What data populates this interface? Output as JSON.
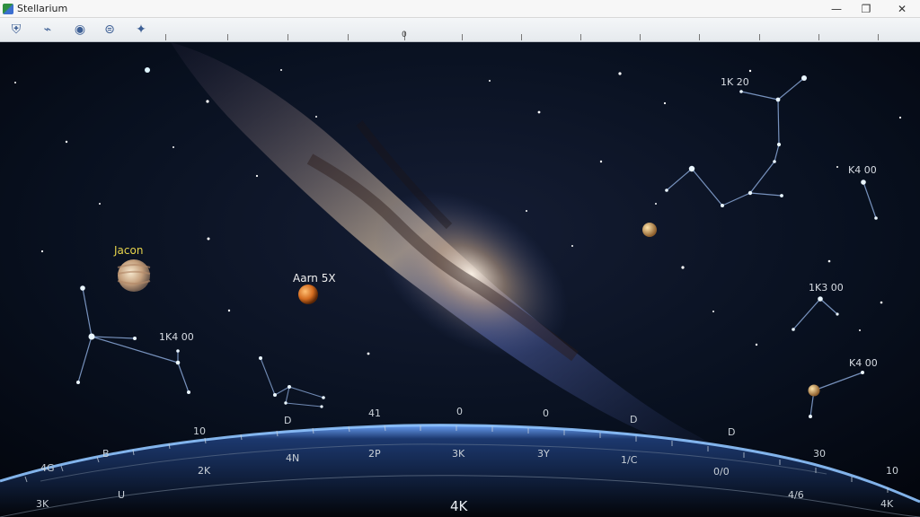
{
  "app": {
    "title": "Stellarium"
  },
  "window_controls": {
    "minimize": "—",
    "maximize": "❐",
    "close": "✕"
  },
  "toolbar": {
    "icons": [
      "shield-icon",
      "telescope-icon",
      "planet-icon",
      "binocular-icon",
      "satellite-icon"
    ],
    "ruler_center_label": "0"
  },
  "sky": {
    "colors": {
      "sky_top": "#04060d",
      "milkyway_core": "#d6c0a4",
      "horizon_glow": "#6fa7ff",
      "constellation": "#8aa8d8"
    },
    "planets": [
      {
        "name": "Jupiter",
        "label": "Jacon"
      },
      {
        "name": "Mars",
        "label": "Aarn 5X"
      },
      {
        "name": "Saturn",
        "label": ""
      },
      {
        "name": "Venus",
        "label": ""
      }
    ],
    "constellation_labels": [
      "1K 20",
      "K4 00",
      "1K3 00",
      "K4 00",
      "1K4 00"
    ],
    "ruler_labels": [
      "D",
      "41",
      "0",
      "0",
      "D",
      "D",
      "B",
      "10"
    ],
    "horizon_labels": [
      "4G",
      "2K",
      "4N",
      "2P",
      "3K",
      "3Y",
      "1/C",
      "0/0",
      "30",
      "10",
      "3K",
      "U",
      "4K",
      "4/6",
      "4K"
    ]
  }
}
